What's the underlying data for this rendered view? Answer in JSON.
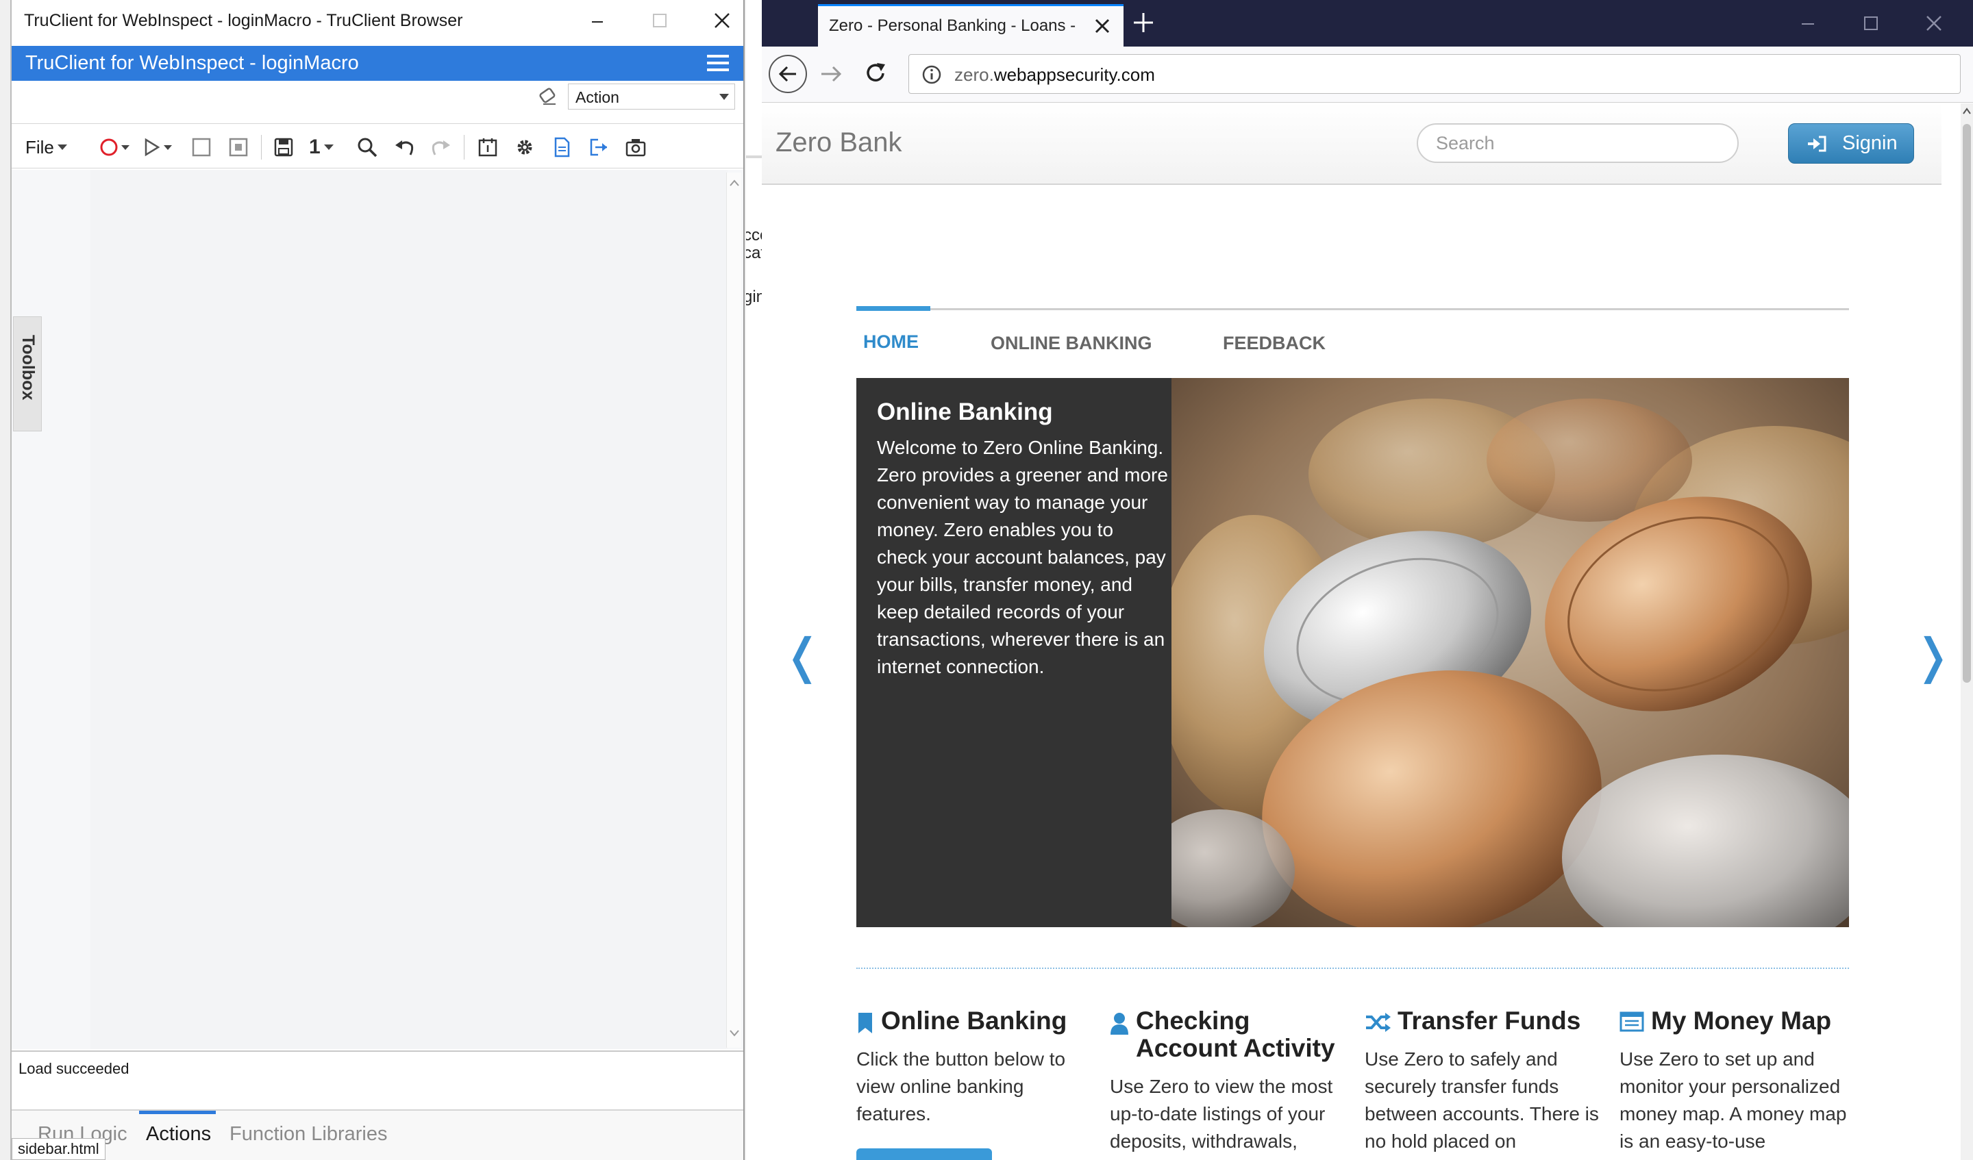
{
  "truclient": {
    "window_title": "TruClient for WebInspect - loginMacro - TruClient Browser",
    "header_title": "TruClient for WebInspect - loginMacro",
    "action_select": "Action",
    "toolbar": {
      "file_label": "File",
      "step_number": "1"
    },
    "toolbox_label": "Toolbox",
    "status_text": "Load succeeded",
    "tabs": [
      "Run Logic",
      "Actions",
      "Function Libraries"
    ],
    "status_file": "sidebar.html",
    "accent_color": "#2e7bdc"
  },
  "background": {
    "fragments": [
      "cce",
      "cat",
      "gin"
    ]
  },
  "browser": {
    "tab_title": "Zero - Personal Banking - Loans - C",
    "url_prefix": "zero.",
    "url_domain": "webappsecurity.com",
    "tabbar_color": "#202340"
  },
  "zerobank": {
    "brand": "Zero Bank",
    "search_placeholder": "Search",
    "signin_label": "Signin",
    "nav_tabs": [
      "HOME",
      "ONLINE BANKING",
      "FEEDBACK"
    ],
    "hero": {
      "title": "Online Banking",
      "body": "Welcome to Zero Online Banking. Zero provides a greener and more convenient way to manage your money. Zero enables you to check your account balances, pay your bills, transfer money, and keep detailed records of your transactions, wherever there is an internet connection."
    },
    "features": [
      {
        "title": "Online Banking",
        "icon": "bookmark-icon",
        "body": "Click the button below to view online banking features."
      },
      {
        "title": "Checking Account Activity",
        "icon": "user-icon",
        "body": "Use Zero to view the most up-to-date listings of your deposits, withdrawals,"
      },
      {
        "title": "Transfer Funds",
        "icon": "shuffle-icon",
        "body": "Use Zero to safely and securely transfer funds between accounts. There is no hold placed on"
      },
      {
        "title": "My Money Map",
        "icon": "list-icon",
        "body": "Use Zero to set up and monitor your personalized money map. A money map is an easy-to-use"
      }
    ],
    "accent_color": "#3a9ad9"
  }
}
